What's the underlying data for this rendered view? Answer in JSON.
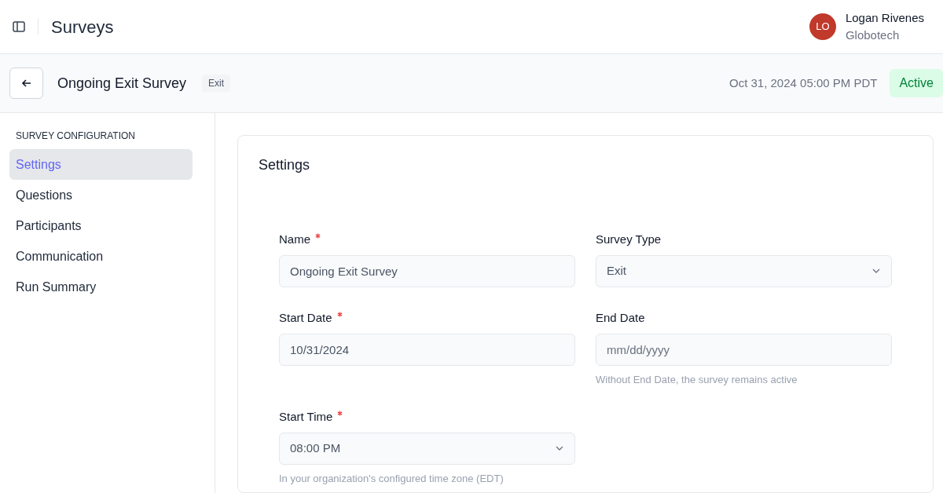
{
  "header": {
    "title": "Surveys",
    "user": {
      "initials": "LO",
      "name": "Logan Rivenes",
      "organization": "Globotech"
    }
  },
  "survey_bar": {
    "title": "Ongoing Exit Survey",
    "type_tag": "Exit",
    "timestamp": "Oct 31, 2024 05:00 PM PDT",
    "status": "Active"
  },
  "sidebar": {
    "heading": "SURVEY CONFIGURATION",
    "items": [
      {
        "label": "Settings",
        "selected": true
      },
      {
        "label": "Questions",
        "selected": false
      },
      {
        "label": "Participants",
        "selected": false
      },
      {
        "label": "Communication",
        "selected": false
      },
      {
        "label": "Run Summary",
        "selected": false
      }
    ]
  },
  "settings": {
    "title": "Settings",
    "fields": [
      {
        "kind": "text",
        "label": "Name",
        "required": true,
        "value": "Ongoing Exit Survey"
      },
      {
        "kind": "select",
        "label": "Survey Type",
        "required": false,
        "value": "Exit"
      },
      {
        "kind": "date",
        "label": "Start Date",
        "required": true,
        "value": "10/31/2024"
      },
      {
        "kind": "date",
        "label": "End Date",
        "required": false,
        "placeholder": "mm/dd/yyyy",
        "hint": "Without End Date, the survey remains active"
      },
      {
        "kind": "select",
        "label": "Start Time",
        "required": true,
        "value": "08:00 PM",
        "hint": "In your organization's configured time zone (EDT)"
      }
    ]
  }
}
